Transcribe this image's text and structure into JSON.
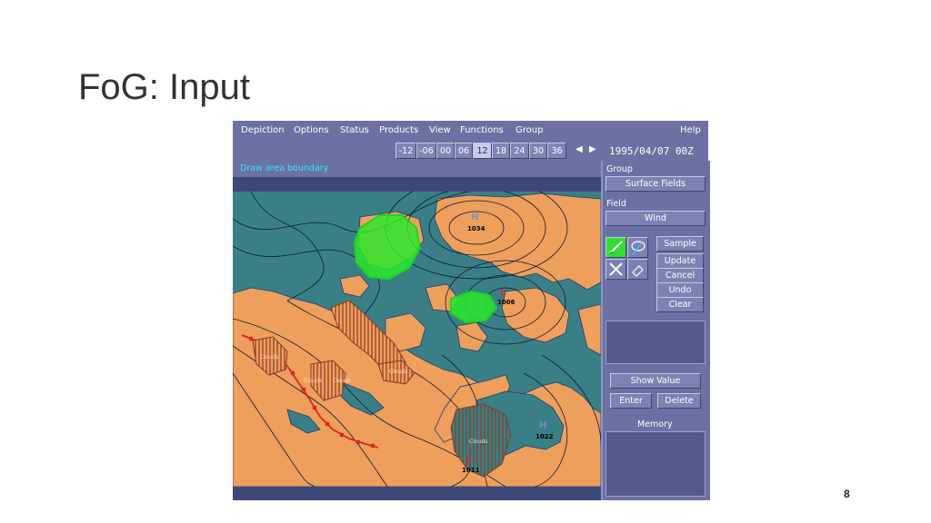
{
  "slide": {
    "title": "FoG: Input",
    "page_number": "8"
  },
  "menubar": {
    "items": [
      "Depiction",
      "Options",
      "Status",
      "Products",
      "View",
      "Functions",
      "Group"
    ],
    "help": "Help"
  },
  "timebar": {
    "steps": [
      "-12",
      "-06",
      "00",
      "06",
      "12",
      "18",
      "24",
      "30",
      "36"
    ],
    "active": "12",
    "prev_icon": "triangle-left-icon",
    "next_icon": "triangle-right-icon",
    "datetime": "1995/04/07 00Z"
  },
  "status": {
    "message": "Draw area boundary"
  },
  "map": {
    "pressure_labels": [
      "1034",
      "1006",
      "1022",
      "1011"
    ],
    "region_labels": [
      "Clouds",
      "Clouds",
      "Clouds",
      "Clouds",
      "Clouds"
    ],
    "colors": {
      "water": "#3a7f86",
      "land": "#ee9f5c",
      "fog_area": "#2be82b",
      "cloud_area": "#a35a3a",
      "front": "#e0231f"
    }
  },
  "panel": {
    "group_label": "Group",
    "group_value": "Surface Fields",
    "field_label": "Field",
    "field_value": "Wind",
    "tools": [
      "pencil-draw-icon",
      "lasso-icon",
      "crossed-tools-icon",
      "eraser-icon"
    ],
    "buttons": [
      "Sample",
      "Update",
      "Cancel",
      "Undo",
      "Clear"
    ],
    "show_value": "Show Value",
    "enter": "Enter",
    "delete": "Delete",
    "memory_label": "Memory"
  }
}
